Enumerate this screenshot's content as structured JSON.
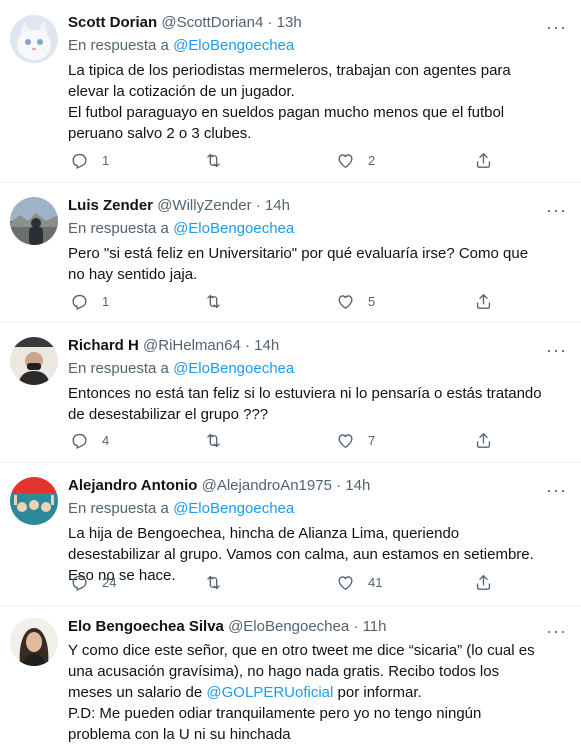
{
  "tweets": [
    {
      "name": "Scott Dorian",
      "handle": "@ScottDorian4",
      "time": "13h",
      "reply_prefix": "En respuesta a",
      "reply_to": "@EloBengoechea",
      "lines": [
        "La tipica de los periodistas mermeleros, trabajan con agentes para elevar la cotización de un jugador.",
        "El futbol paraguayo en sueldos pagan mucho menos que el futbol peruano salvo 2 o 3 clubes."
      ],
      "replies": "1",
      "retweets": "",
      "likes": "2",
      "avatar_colors": [
        "#dfe6ef",
        "#b9c6d6"
      ]
    },
    {
      "name": "Luis Zender",
      "handle": "@WillyZender",
      "time": "14h",
      "reply_prefix": "En respuesta a",
      "reply_to": "@EloBengoechea",
      "lines": [
        "Pero \"si está feliz en Universitario\" por qué evaluaría irse? Como que no hay sentido jaja."
      ],
      "replies": "1",
      "retweets": "",
      "likes": "5",
      "avatar_colors": [
        "#9fb3c8",
        "#3d4248"
      ]
    },
    {
      "name": "Richard H",
      "handle": "@RiHelman64",
      "time": "14h",
      "reply_prefix": "En respuesta a",
      "reply_to": "@EloBengoechea",
      "lines": [
        "Entonces no está tan feliz si lo estuviera ni lo pensaría o estás tratando de desestabilizar el grupo ???"
      ],
      "replies": "4",
      "retweets": "",
      "likes": "7",
      "avatar_colors": [
        "#e8e2dc",
        "#2b2b2b"
      ]
    },
    {
      "name": "Alejandro Antonio",
      "handle": "@AlejandroAn1975",
      "time": "14h",
      "reply_prefix": "En respuesta a",
      "reply_to": "@EloBengoechea",
      "lines": [
        "La hija de Bengoechea, hincha de Alianza Lima, queriendo desestabilizar al grupo. Vamos con calma, aun estamos en setiembre. Eso no se hace."
      ],
      "replies": "24",
      "retweets": "",
      "likes": "41",
      "avatar_colors": [
        "#e3342f",
        "#2b8a9a"
      ]
    },
    {
      "name": "Elo Bengoechea Silva",
      "handle": "@EloBengoechea",
      "time": "11h",
      "reply_prefix": "",
      "reply_to": "",
      "lines": [
        "Y como dice este señor, que en otro tweet me dice “sicaria” (lo cual es una acusación gravísima), no hago nada gratis. Recibo todos los meses un salario de ",
        "P.D: Me pueden odiar tranquilamente pero yo no tengo ningún problema con la U ni su hinchada"
      ],
      "mention": "@GOLPERUoficial",
      "mention_suffix": " por informar.",
      "replies": "",
      "retweets": "",
      "likes": "",
      "avatar_colors": [
        "#f2efe9",
        "#3a2b22"
      ]
    }
  ],
  "colors": {
    "accent": "#1d9bf0",
    "muted": "#536471",
    "text": "#0f1419"
  }
}
